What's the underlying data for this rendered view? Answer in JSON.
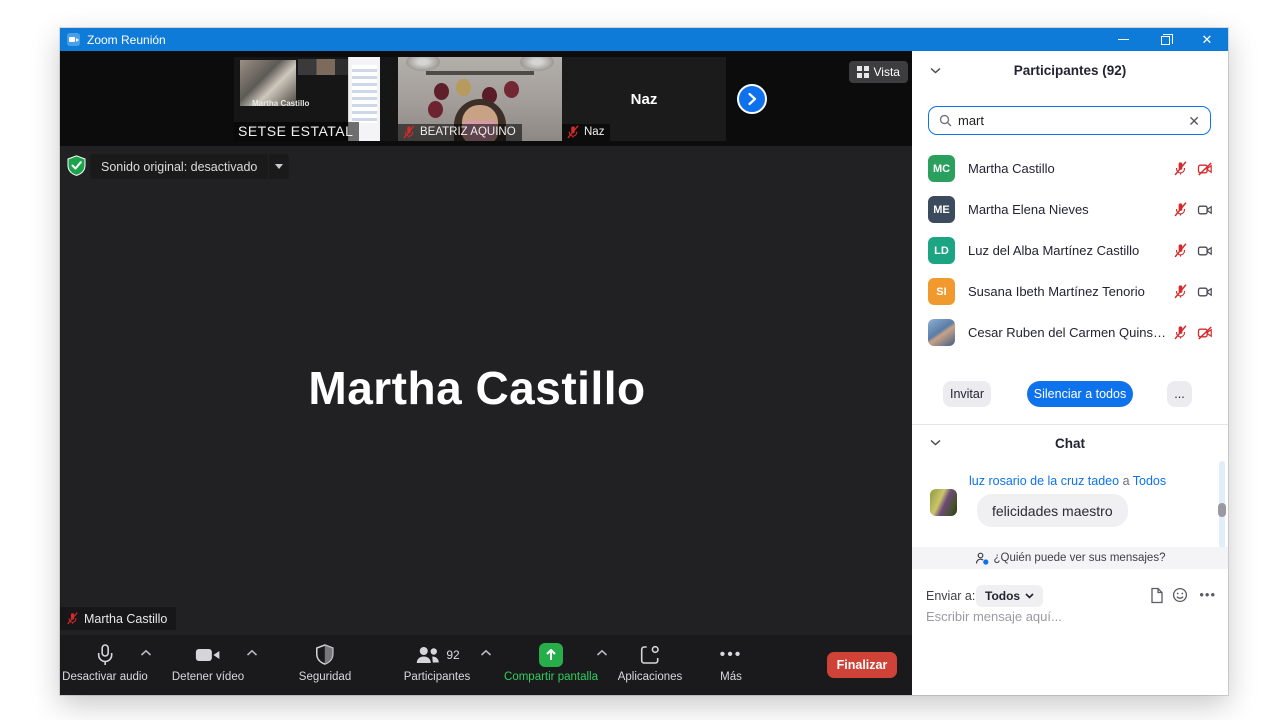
{
  "title_bar": {
    "title": "Zoom Reunión"
  },
  "filmstrip": {
    "view_button": "Vista",
    "thumbnails": [
      {
        "label": "SETSE ESTATAL",
        "inner_name": "Martha Castillo",
        "muted": false
      },
      {
        "label": "BEATRIZ AQUINO",
        "muted": true
      },
      {
        "label": "Naz",
        "display_name": "Naz",
        "muted": true
      }
    ]
  },
  "stage": {
    "audio_pill": "Sonido original: desactivado",
    "speaker_name": "Martha Castillo",
    "nametag": "Martha Castillo",
    "nametag_muted": true
  },
  "toolbar": {
    "mute_label": "Desactivar audio",
    "video_label": "Detener vídeo",
    "security_label": "Seguridad",
    "participants_label": "Participantes",
    "participants_count": "92",
    "share_label": "Compartir pantalla",
    "apps_label": "Aplicaciones",
    "more_label": "Más",
    "more_glyph": "•••",
    "end_label": "Finalizar"
  },
  "participants_panel": {
    "header": "Participantes (92)",
    "search_value": "mart",
    "participants": [
      {
        "initials": "MC",
        "avatar_color": "#2ba05e",
        "name": "Martha Castillo",
        "mic_muted": true,
        "video_off": true
      },
      {
        "initials": "ME",
        "avatar_color": "#3c4a5e",
        "name": "Martha Elena Nieves",
        "mic_muted": true,
        "video_off": false
      },
      {
        "initials": "LD",
        "avatar_color": "#1ca583",
        "name": "Luz del Alba Martínez Castillo",
        "mic_muted": true,
        "video_off": false
      },
      {
        "initials": "SI",
        "avatar_color": "#f2992e",
        "name": "Susana Ibeth Martínez Tenorio",
        "mic_muted": true,
        "video_off": false
      },
      {
        "initials": "",
        "avatar_color": "linear-gradient(145deg,#8fb0d6 0%,#5a7ca6 45%,#c9a386 55%,#3f5e86 100%)",
        "name": "Cesar Ruben del Carmen Quinsh...",
        "mic_muted": true,
        "video_off": true
      }
    ],
    "invite_button": "Invitar",
    "mute_all_button": "Silenciar a todos",
    "more_button": "..."
  },
  "chat_panel": {
    "header": "Chat",
    "message": {
      "sender": "luz rosario de la cruz tadeo",
      "connector": "a",
      "recipient": "Todos",
      "text": "felicidades maestro"
    },
    "privacy_note": "¿Quién puede ver sus mensajes?",
    "send_to_label": "Enviar a:",
    "send_to_value": "Todos",
    "input_placeholder": "Escribir mensaje aquí..."
  },
  "colors": {
    "accent_blue": "#0e72ed",
    "titlebar_blue": "#0f7bd9",
    "mute_red": "#d42a2a",
    "share_green": "#27ae4b",
    "end_red": "#cf4238"
  }
}
